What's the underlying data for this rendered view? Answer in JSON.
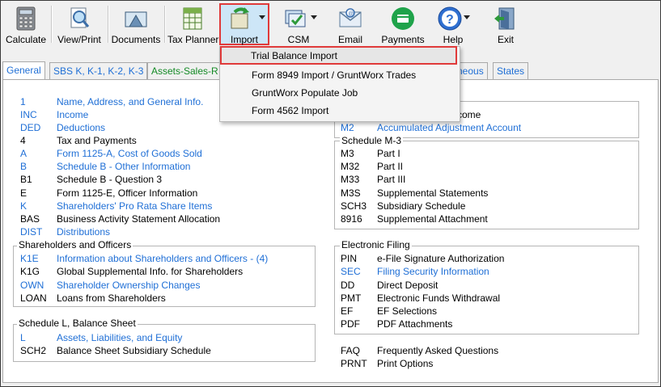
{
  "toolbar": {
    "calculate": "Calculate",
    "view_print": "View/Print",
    "documents": "Documents",
    "tax_planner": "Tax Planner",
    "import": "Import",
    "csm": "CSM",
    "email": "Email",
    "payments": "Payments",
    "help": "Help",
    "exit": "Exit"
  },
  "tabs": {
    "general": "General",
    "sbs": "SBS K, K-1, K-2, K-3",
    "assets": "Assets-Sales-R",
    "misc": "neous",
    "states": "States"
  },
  "import_menu": {
    "trial_balance": "Trial Balance Import",
    "form_8949": "Form 8949 Import / GruntWorx Trades",
    "gruntworx": "GruntWorx Populate Job",
    "form_4562": "Form 4562 Import"
  },
  "left": {
    "r1": {
      "code": "1",
      "desc": "Name, Address, and General Info."
    },
    "r2": {
      "code": "INC",
      "desc": "Income"
    },
    "r3": {
      "code": "DED",
      "desc": "Deductions"
    },
    "r4": {
      "code": "4",
      "desc": "Tax and Payments"
    },
    "r5": {
      "code": "A",
      "desc": "Form 1125-A, Cost of Goods Sold"
    },
    "r6": {
      "code": "B",
      "desc": "Schedule B - Other Information"
    },
    "r7": {
      "code": "B1",
      "desc": "Schedule B - Question 3"
    },
    "r8": {
      "code": "E",
      "desc": "Form 1125-E, Officer Information"
    },
    "r9": {
      "code": "K",
      "desc": "Shareholders' Pro Rata Share Items"
    },
    "r10": {
      "code": "BAS",
      "desc": "Business Activity Statement Allocation"
    },
    "r11": {
      "code": "DIST",
      "desc": "Distributions"
    }
  },
  "shareholders": {
    "title": "Shareholders and Officers",
    "r1": {
      "code": "K1E",
      "desc": "Information about Shareholders and Officers - (4)"
    },
    "r2": {
      "code": "K1G",
      "desc": "Global Supplemental Info. for Shareholders"
    },
    "r3": {
      "code": "OWN",
      "desc": "Shareholder Ownership Changes"
    },
    "r4": {
      "code": "LOAN",
      "desc": "Loans from Shareholders"
    }
  },
  "schedule_l": {
    "title": "Schedule L, Balance Sheet",
    "r1": {
      "code": "L",
      "desc": "Assets, Liabilities, and Equity"
    },
    "r2": {
      "code": "SCH2",
      "desc": "Balance Sheet Subsidiary Schedule"
    }
  },
  "right_top": {
    "partial": "come",
    "r1": {
      "code": "M2",
      "desc": "Accumulated Adjustment Account"
    }
  },
  "schedule_m3": {
    "title": "Schedule M-3",
    "r1": {
      "code": "M3",
      "desc": "Part I"
    },
    "r2": {
      "code": "M32",
      "desc": "Part II"
    },
    "r3": {
      "code": "M33",
      "desc": "Part III"
    },
    "r4": {
      "code": "M3S",
      "desc": "Supplemental Statements"
    },
    "r5": {
      "code": "SCH3",
      "desc": "Subsidiary Schedule"
    },
    "r6": {
      "code": "8916",
      "desc": "Supplemental Attachment"
    }
  },
  "efiling": {
    "title": "Electronic Filing",
    "r1": {
      "code": "PIN",
      "desc": "e-File Signature Authorization"
    },
    "r2": {
      "code": "SEC",
      "desc": "Filing Security Information"
    },
    "r3": {
      "code": "DD",
      "desc": "Direct Deposit"
    },
    "r4": {
      "code": "PMT",
      "desc": "Electronic Funds Withdrawal"
    },
    "r5": {
      "code": "EF",
      "desc": "EF Selections"
    },
    "r6": {
      "code": "PDF",
      "desc": "PDF Attachments"
    }
  },
  "bottom_right": {
    "r1": {
      "code": "FAQ",
      "desc": "Frequently Asked Questions"
    },
    "r2": {
      "code": "PRNT",
      "desc": "Print Options"
    }
  }
}
